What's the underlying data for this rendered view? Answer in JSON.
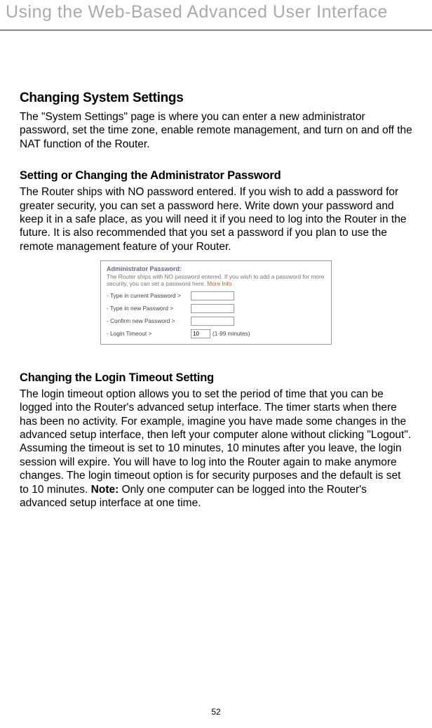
{
  "header": {
    "title": "Using the Web-Based Advanced User Interface"
  },
  "section1": {
    "title": "Changing System Settings",
    "body": "The \"System Settings\" page is where you can enter a new administrator password, set the time zone, enable remote management, and turn on and off the NAT function of the Router."
  },
  "section2": {
    "title": "Setting or Changing the Administrator Password",
    "body": "The Router ships with NO password entered. If you wish to add a password for greater security, you can set a password here. Write down your password and keep it in a safe place, as you will need it if you need to log into the Router in the future. It is also recommended that you set a password if you plan to use the remote management feature of your Router."
  },
  "panel": {
    "title": "Administrator Password:",
    "desc_prefix": "The Router ships with NO password entered. If you wish to add a password for more security, you can set a password here. ",
    "more_info": "More Info",
    "row1_label": "- Type in current Password >",
    "row2_label": "- Type in new Password >",
    "row3_label": "- Confirm new Password >",
    "row4_label": "- Login Timeout >",
    "timeout_value": "10",
    "timeout_suffix": "(1-99 minutes)"
  },
  "section3": {
    "title": "Changing the Login Timeout Setting",
    "body_before_note": "The login timeout option allows you to set the period of time that you can be logged into the Router's advanced setup interface. The timer starts when there has been no activity. For example, imagine you have made some changes in the advanced setup interface, then left your computer alone without clicking \"Logout\". Assuming the timeout is set to 10 minutes, 10 minutes after you leave, the login session will expire. You will have to log into the Router again to make anymore changes. The login timeout option is for security purposes and the default is set to 10 minutes. ",
    "note_label": "Note:",
    "body_after_note": " Only one computer can be logged into the Router's advanced setup interface at one time."
  },
  "page_number": "52"
}
